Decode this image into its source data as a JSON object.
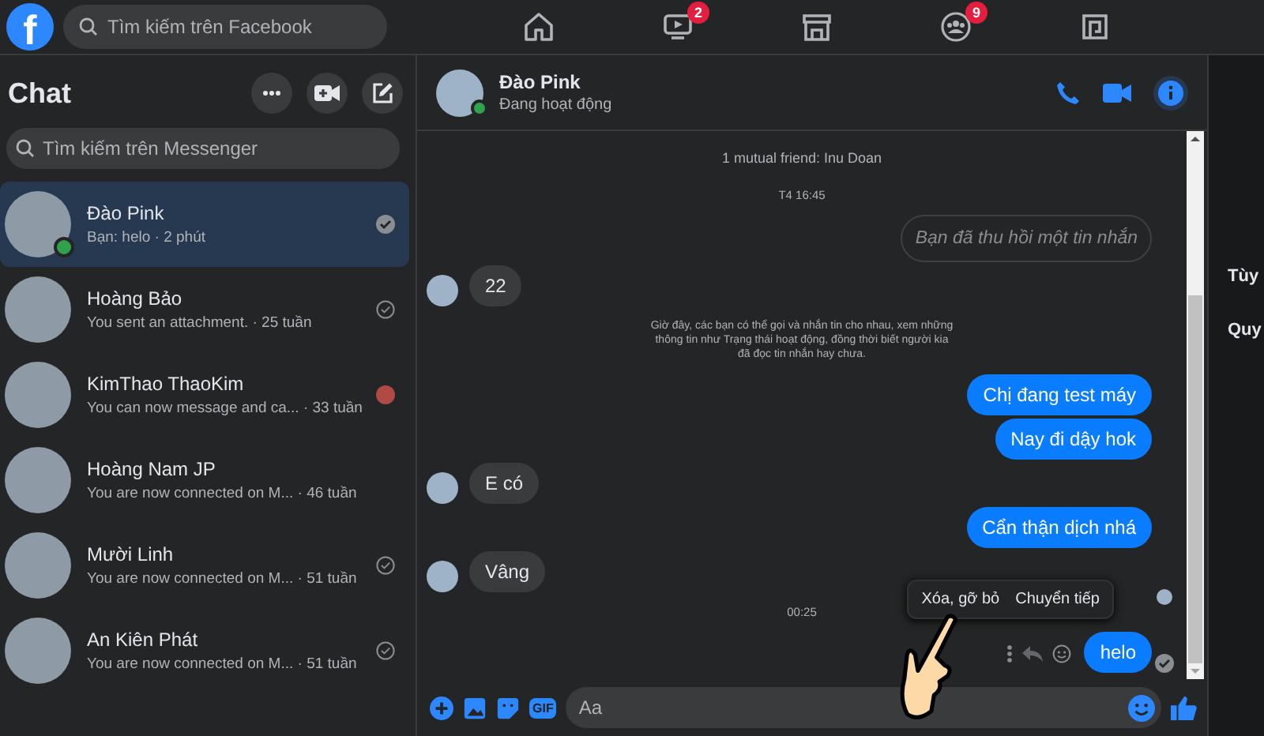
{
  "topbar": {
    "logo": "f",
    "search": {
      "placeholder": "Tìm kiếm trên Facebook"
    },
    "nav": [
      {
        "kind": "home"
      },
      {
        "kind": "video",
        "badge": "2"
      },
      {
        "kind": "market"
      },
      {
        "kind": "groups",
        "badge": "9"
      },
      {
        "kind": "gaming"
      }
    ]
  },
  "sidebar": {
    "title": "Chat",
    "search": {
      "placeholder": "Tìm kiếm trên Messenger"
    },
    "conversations": [
      {
        "name": "Đào Pink",
        "preview": "Bạn: helo · 2 phút",
        "selected": true,
        "online": true,
        "receipt": {
          "kind": "read"
        }
      },
      {
        "name": "Hoàng Bảo",
        "preview": "You sent an attachment. · 25 tuần",
        "selected": false,
        "online": false,
        "receipt": {
          "kind": "sent"
        }
      },
      {
        "name": "KimThao ThaoKim",
        "preview": "You can now message and ca... · 33 tuần",
        "selected": false,
        "online": false,
        "receipt": {
          "kind": "seen"
        }
      },
      {
        "name": "Hoàng Nam JP",
        "preview": "You are now connected on M...  · 46 tuần",
        "selected": false,
        "online": false
      },
      {
        "name": "Mười Linh",
        "preview": "You are now connected on M... · 51 tuần",
        "selected": false,
        "online": false,
        "receipt": {
          "kind": "sent"
        }
      },
      {
        "name": "An Kiên Phát",
        "preview": "You are now connected on M... · 51 tuần",
        "selected": false,
        "online": false,
        "receipt": {
          "kind": "sent"
        }
      }
    ]
  },
  "chat": {
    "name": "Đào Pink",
    "status": "Đang hoạt động",
    "online": true,
    "messages": [
      {
        "kind": "system",
        "text": "1 mutual friend: Inu Doan"
      },
      {
        "kind": "time",
        "text": "T4 16:45"
      },
      {
        "kind": "unsent",
        "text": "Bạn đã thu hồi một tin nhắn"
      },
      {
        "kind": "in",
        "text": "22"
      },
      {
        "kind": "system",
        "text": "Giờ đây, các bạn có thể gọi và nhắn tin cho nhau, xem những thông tin như Trạng thái hoạt động, đồng thời biết người kia đã đọc tin nhắn hay chưa."
      },
      {
        "kind": "out",
        "text": "Chị đang test máy"
      },
      {
        "kind": "out",
        "text": "Nay đi dậy hok"
      },
      {
        "kind": "in",
        "text": "E có"
      },
      {
        "kind": "out",
        "text": "Cẩn thận dịch nhá"
      },
      {
        "kind": "in",
        "text": "Vâng",
        "receipt": {
          "kind": "seen"
        }
      },
      {
        "kind": "time",
        "text": "00:25"
      },
      {
        "kind": "out",
        "text": "helo",
        "receipt": {
          "kind": "read"
        },
        "menu": [
          "Xóa, gỡ bỏ",
          "Chuyển tiếp"
        ]
      }
    ],
    "composer": {
      "gif": "GIF",
      "placeholder": "Aa"
    }
  },
  "right_panel": {
    "items": [
      "Tùy",
      "Quy"
    ]
  }
}
